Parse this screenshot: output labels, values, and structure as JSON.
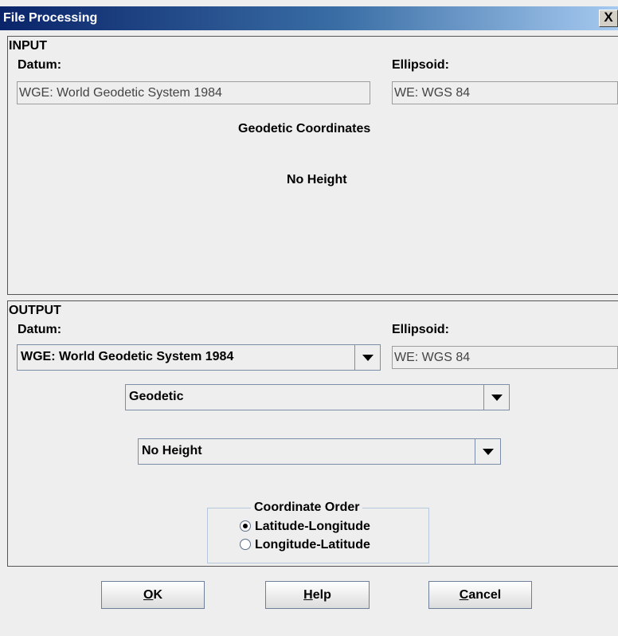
{
  "window": {
    "title": "File Processing",
    "close_glyph": "X"
  },
  "input": {
    "heading": "INPUT",
    "datum_label": "Datum:",
    "datum_value": "WGE: World Geodetic System 1984",
    "ellipsoid_label": "Ellipsoid:",
    "ellipsoid_value": "WE: WGS 84",
    "coordinates_text": "Geodetic Coordinates",
    "height_text": "No Height"
  },
  "output": {
    "heading": "OUTPUT",
    "datum_label": "Datum:",
    "datum_selected": "WGE: World Geodetic System 1984",
    "ellipsoid_label": "Ellipsoid:",
    "ellipsoid_value": "WE: WGS 84",
    "coord_type_selected": "Geodetic",
    "height_selected": "No Height",
    "coordinate_order": {
      "legend": "Coordinate Order",
      "options": [
        {
          "label": "Latitude-Longitude",
          "selected": true
        },
        {
          "label": "Longitude-Latitude",
          "selected": false
        }
      ]
    }
  },
  "buttons": {
    "ok": {
      "mnemonic": "O",
      "rest": "K"
    },
    "help": {
      "mnemonic": "H",
      "rest": "elp"
    },
    "cancel": {
      "mnemonic": "C",
      "rest": "ancel"
    }
  },
  "icons": [
    "close-icon",
    "dropdown-arrow-icon",
    "radio-icon"
  ]
}
